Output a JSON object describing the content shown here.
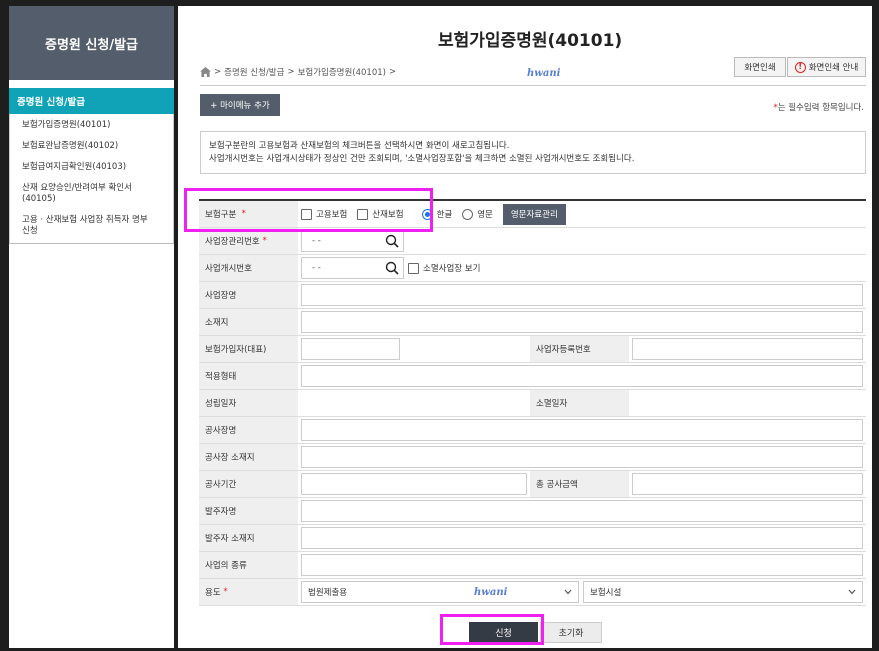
{
  "sidebar": {
    "header": "증명원 신청/발급",
    "active": "증명원 신청/발급",
    "items": [
      {
        "label": "보험가입증명원(40101)"
      },
      {
        "label": "보험료완납증명원(40102)"
      },
      {
        "label": "보험급여지급확인원(40103)"
      },
      {
        "label": "산재 요양승인/반려여부 확인서\n(40105)"
      },
      {
        "label": "고용 · 산재보험 사업장 취득자 명부\n신청"
      }
    ]
  },
  "header": {
    "title": "보험가입증명원(40101)",
    "breadcrumb": [
      "증명원 신청/발급",
      "보험가입증명원(40101)"
    ],
    "watermark": "hwani",
    "print_label": "화면인쇄",
    "guide_label": "화면인쇄 안내"
  },
  "toolbar": {
    "mymenu_label": "+ 마이메뉴 추가",
    "required_note": "는 필수입력 항목입니다.",
    "required_star": "*"
  },
  "notice": {
    "line1": "보험구분란의 고용보험과 산재보험의 체크버튼을 선택하시면 화면이 새로고침됩니다.",
    "line2": "사업개시번호는 사업개시상태가 정상인 건만 조회되며, '소멸사업장포함'을 체크하면 소멸된 사업개시번호도 조회됩니다."
  },
  "form": {
    "insurance_type_label": "보험구분",
    "employment_label": "고용보험",
    "industrial_label": "산재보험",
    "korean_label": "한글",
    "english_label": "영문",
    "english_mgmt_button": "영문자료관리",
    "mgmt_no_label": "사업장관리번호",
    "mgmt_no_value": "-   -",
    "start_no_label": "사업개시번호",
    "start_no_value": "-   -",
    "show_closed_label": "소멸사업장 보기",
    "workplace_name_label": "사업장명",
    "address_label": "소재지",
    "insured_label": "보험가입자(대표)",
    "biz_reg_label": "사업자등록번호",
    "apply_type_label": "적용형태",
    "established_label": "성립일자",
    "closed_label": "소멸일자",
    "site_name_label": "공사장명",
    "site_address_label": "공사장 소재지",
    "period_label": "공사기간",
    "total_amount_label": "총 공사금액",
    "client_label": "발주자명",
    "client_address_label": "발주자 소재지",
    "biz_type_label": "사업의 종류",
    "purpose_label": "용도",
    "purpose_value": "법원제출용",
    "purpose_value2": "보험시설"
  },
  "actions": {
    "submit_label": "신청",
    "reset_label": "초기화"
  },
  "colors": {
    "sidebar_header": "#545d6b",
    "sidebar_active": "#10a2b6",
    "highlight": "#f020f0",
    "required": "#e02020"
  }
}
